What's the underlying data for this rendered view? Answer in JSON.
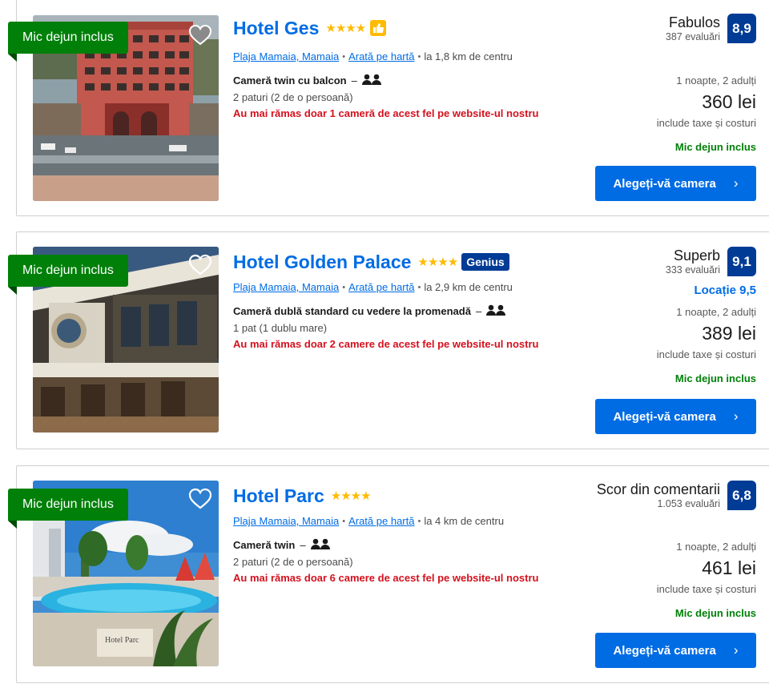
{
  "hotels": [
    {
      "ribbon": "Mic dejun inclus",
      "name": "Hotel Ges",
      "stars": "★★★★",
      "badge_icon": "thumbs-up-icon",
      "location": "Plaja Mamaia, Mamaia",
      "map_link": "Arată pe hartă",
      "distance": "la 1,8 km de centru",
      "room": "Cameră twin cu balcon",
      "beds": "2 paturi (2 de o persoană)",
      "availability": "Au mai rămas doar 1 cameră de acest fel pe website-ul nostru",
      "rating_word": "Fabulos",
      "reviews": "387 evaluări",
      "score": "8,9",
      "nights": "1 noapte, 2 adulți",
      "price": "360 lei",
      "taxes": "include taxe și costuri",
      "breakfast": "Mic dejun inclus",
      "cta": "Alegeți-vă camera"
    },
    {
      "ribbon": "Mic dejun inclus",
      "name": "Hotel Golden Palace",
      "stars": "★★★★",
      "genius": "Genius",
      "location": "Plaja Mamaia, Mamaia",
      "map_link": "Arată pe hartă",
      "distance": "la 2,9 km de centru",
      "room": "Cameră dublă standard cu vedere la promenadă",
      "beds": "1 pat (1 dublu mare)",
      "availability": "Au mai rămas doar 2 camere de acest fel pe website-ul nostru",
      "rating_word": "Superb",
      "reviews": "333 evaluări",
      "score": "9,1",
      "location_score": "Locație 9,5",
      "nights": "1 noapte, 2 adulți",
      "price": "389 lei",
      "taxes": "include taxe și costuri",
      "breakfast": "Mic dejun inclus",
      "cta": "Alegeți-vă camera"
    },
    {
      "ribbon": "Mic dejun inclus",
      "name": "Hotel Parc",
      "stars": "★★★★",
      "location": "Plaja Mamaia, Mamaia",
      "map_link": "Arată pe hartă",
      "distance": "la 4 km de centru",
      "room": "Cameră twin",
      "beds": "2 paturi (2 de o persoană)",
      "availability": "Au mai rămas doar 6 camere de acest fel pe website-ul nostru",
      "rating_word": "Scor din comentarii",
      "reviews": "1.053 evaluări",
      "score": "6,8",
      "nights": "1 noapte, 2 adulți",
      "price": "461 lei",
      "taxes": "include taxe și costuri",
      "breakfast": "Mic dejun inclus",
      "cta": "Alegeți-vă camera",
      "photo_sign": "Hotel Parc"
    }
  ],
  "colors": {
    "link": "#006ce4",
    "score_bg": "#003b95",
    "ribbon": "#008009",
    "urgency": "#d4111e",
    "star": "#febb02"
  }
}
